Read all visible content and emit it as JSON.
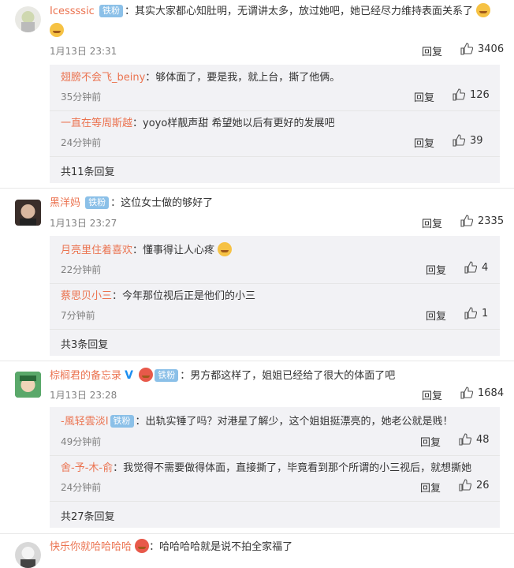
{
  "comments": [
    {
      "user": "Icessssic",
      "badge": "铁粉",
      "text": "：其实大家都心知肚明，无谓讲太多，放过她吧，她已经尽力维持表面关系了",
      "time": "1月13日 23:31",
      "reply_label": "回复",
      "likes": "3406",
      "replies": [
        {
          "user": "翅膀不会飞_beiny",
          "text": "：够体面了，要是我，就上台，撕了他俩。",
          "time": "35分钟前",
          "reply_label": "回复",
          "likes": "126"
        },
        {
          "user": "一直在等周斯越",
          "text": "：yoyo样靓声甜 希望她以后有更好的发展吧",
          "time": "24分钟前",
          "reply_label": "回复",
          "likes": "39"
        }
      ],
      "more": "共11条回复"
    },
    {
      "user": "黑洋妈",
      "badge": "铁粉",
      "text": "：这位女士做的够好了",
      "time": "1月13日 23:27",
      "reply_label": "回复",
      "likes": "2335",
      "replies": [
        {
          "user": "月亮里住着喜欢",
          "text": "：懂事得让人心疼",
          "time": "22分钟前",
          "reply_label": "回复",
          "likes": "4"
        },
        {
          "user": "蔡思贝小三",
          "text": "：今年那位视后正是他们的小三",
          "time": "7分钟前",
          "reply_label": "回复",
          "likes": "1"
        }
      ],
      "more": "共3条回复"
    },
    {
      "user": "棕榈君的备忘录",
      "badge": "铁粉",
      "text": "：男方都这样了，姐姐已经给了很大的体面了吧",
      "time": "1月13日 23:28",
      "reply_label": "回复",
      "likes": "1684",
      "replies": [
        {
          "user": "-風轻雲淡I",
          "badge": "铁粉",
          "text": "：出轨实锤了吗？对港星了解少，这个姐姐挺漂亮的，她老公就是贱！",
          "time": "49分钟前",
          "reply_label": "回复",
          "likes": "48"
        },
        {
          "user": "舍-予-木-俞",
          "text": "：我觉得不需要做得体面，直接撕了，毕竟看到那个所谓的小三视后，就想撕她",
          "time": "24分钟前",
          "reply_label": "回复",
          "likes": "26"
        }
      ],
      "more": "共27条回复"
    },
    {
      "user": "快乐你就哈哈哈哈",
      "text": "：哈哈哈哈就是说不拍全家福了"
    }
  ],
  "icons": {
    "like": "thumbs-up-icon",
    "verified": "verified-v-icon",
    "emoji": "laughing-emoji-icon"
  },
  "colors": {
    "username": "#eb7350",
    "meta": "#808080",
    "reply_bg": "#f2f2f5",
    "badge": "#8bc0e8"
  }
}
